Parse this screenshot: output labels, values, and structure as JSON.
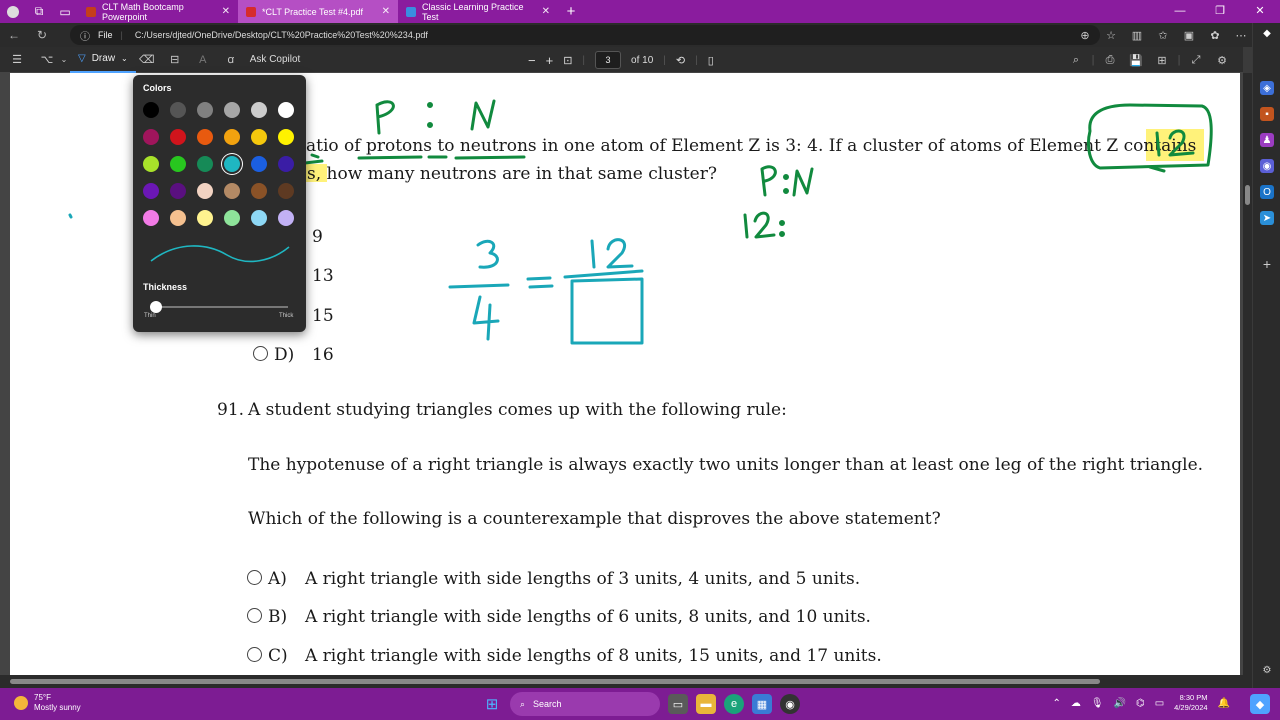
{
  "browser": {
    "tabs": [
      {
        "title": "CLT Math Bootcamp Powerpoint",
        "favicon_color": "#c43e1c"
      },
      {
        "title": "*CLT Practice Test #4.pdf",
        "favicon_color": "#d62c2c",
        "active": true
      },
      {
        "title": "Classic Learning Practice Test",
        "favicon_color": "#3a8de0"
      }
    ],
    "new_tab": "+",
    "url_label": "File",
    "url": "C:/Users/djted/OneDrive/Desktop/CLT%20Practice%20Test%20%234.pdf"
  },
  "pdf_toolbar": {
    "draw_label": "Draw",
    "ask_copilot": "Ask Copilot",
    "zoom_minus": "−",
    "zoom_plus": "+",
    "page_current": "3",
    "page_total": "of 10"
  },
  "draw_popup": {
    "colors_title": "Colors",
    "thickness_title": "Thickness",
    "thin_label": "Thin",
    "thick_label": "Thick",
    "swatches": [
      [
        "#000000",
        "#555555",
        "#808080",
        "#a6a6a6",
        "#cccccc",
        "#ffffff"
      ],
      [
        "#a0155c",
        "#d1141c",
        "#e85a0f",
        "#f2a20f",
        "#f5c80d",
        "#fff200"
      ],
      [
        "#a8e22a",
        "#28c61f",
        "#168a57",
        "#1fb7c2",
        "#1b5fe0",
        "#3a1da5"
      ],
      [
        "#6b17b5",
        "#5a1080",
        "#f2d3c2",
        "#b48a65",
        "#8a5227",
        "#5e3a22"
      ],
      [
        "#f27be6",
        "#f5c08f",
        "#fff38f",
        "#8ee39a",
        "#8ed8f5",
        "#c2b1f5"
      ]
    ],
    "selected_color": "#1fb7c2"
  },
  "document": {
    "q90": {
      "line1": "atio of protons to neutrons in one atom of Element Z is 3: 4. If a cluster of atoms of Element Z contains",
      "line2": "s, how many neutrons are in that same cluster?",
      "choices": [
        {
          "letter": "",
          "text": "9"
        },
        {
          "letter": "",
          "text": "13"
        },
        {
          "letter": "",
          "text": "15"
        },
        {
          "letter": "D)",
          "text": "16"
        }
      ]
    },
    "q91": {
      "number": "91.",
      "stem": "A student studying triangles comes up with the following rule:",
      "rule": "The hypotenuse of a right triangle is always exactly two units longer than at least one leg of the right triangle.",
      "question": "Which of the following is a counterexample that disproves the above statement?",
      "choices": [
        {
          "letter": "A)",
          "text": "A right triangle with side lengths of 3 units, 4 units, and 5 units."
        },
        {
          "letter": "B)",
          "text": "A right triangle with side lengths of 6 units, 8 units, and 10 units."
        },
        {
          "letter": "C)",
          "text": "A right triangle with side lengths of 8 units, 15 units, and 17 units."
        }
      ]
    }
  },
  "taskbar": {
    "weather_temp": "75°F",
    "weather_desc": "Mostly sunny",
    "search_label": "Search",
    "time": "8:30 PM",
    "date": "4/29/2024"
  },
  "colors": {
    "browser_chrome": "#8a1c9e",
    "taskbar": "#7d1c93",
    "ink_green": "#118a3e",
    "ink_teal": "#1aa7b8",
    "highlight": "#fff27a"
  }
}
